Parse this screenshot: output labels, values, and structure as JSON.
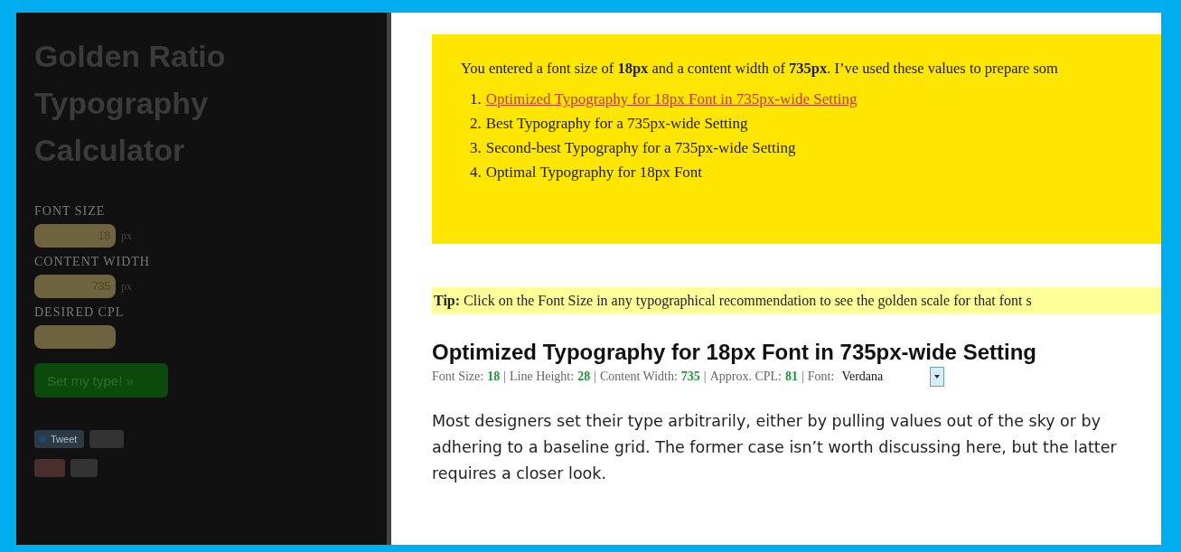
{
  "sidebar": {
    "title": "Golden Ratio Typography Calculator",
    "fields": [
      {
        "label": "FONT SIZE",
        "value": "18",
        "unit": "px"
      },
      {
        "label": "CONTENT WIDTH",
        "value": "735",
        "unit": "px"
      },
      {
        "label": "DESIRED CPL"
      }
    ],
    "button": "Set my type! »",
    "share": [
      {
        "kind": "tweet",
        "label": "Tweet"
      },
      {
        "kind": "plus"
      }
    ]
  },
  "intro": "You entered a font size of **18px** and a content width of **735px**. I’ve used these values to prepare som",
  "recommendations": [
    {
      "number": "1.",
      "text": "Optimized Typography for 18px Font in 735px-wide Setting",
      "selected": true
    },
    {
      "number": "2.",
      "text": "Best Typography for a 735px-wide Setting",
      "selected": false
    },
    {
      "number": "3.",
      "text": "Second-best Typography for a 735px-wide Setting",
      "selected": false
    },
    {
      "number": "4.",
      "text": "Optimal Typography for 18px Font",
      "selected": false
    }
  ],
  "tip": "**Tip:** Click on the Font Size in any typographical recommendation to see the golden scale for that font s",
  "heading": "Optimized Typography for 18px Font in 735px-wide Setting",
  "meta": [
    {
      "label": "Font Size:",
      "value": "18",
      "separator": "|"
    },
    {
      "label": "Line Height:",
      "value": "28",
      "separator": "|"
    },
    {
      "label": "Content Width:",
      "value": "735",
      "separator": "|"
    },
    {
      "label": "Approx. CPL:",
      "value": "81",
      "separator": "|"
    }
  ],
  "font": {
    "label": "Font:",
    "value": "Verdana"
  },
  "body": "Most designers set their type arbitrarily, either by pulling values out of the sky or by adhering to a baseline grid. The former case isn’t worth discussing here, but the latter requires a closer look."
}
